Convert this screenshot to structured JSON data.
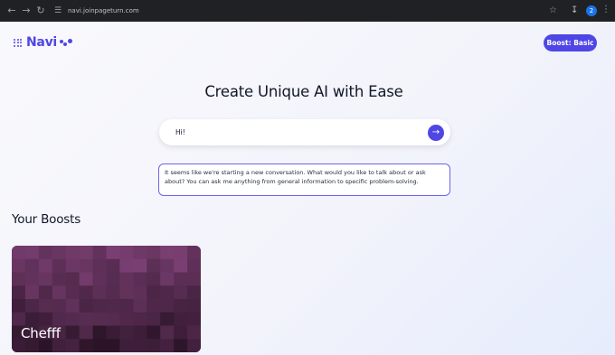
{
  "browser": {
    "url": "navi.joinpageturn.com",
    "profile_initial": "2",
    "icons": [
      "back-icon",
      "forward-icon",
      "reload-icon",
      "site-info-icon",
      "bookmark-star-icon",
      "download-icon",
      "more-menu-icon"
    ]
  },
  "header": {
    "logo_text": "Navi",
    "boost_button": "Boost: Basic"
  },
  "main": {
    "headline": "Create Unique AI with Ease",
    "chat_input_value": "Hi!",
    "response_text": "It seems like we're starting a new conversation. What would you like to talk about or ask about? You can ask me anything from general information to specific problem-solving."
  },
  "boosts": {
    "section_title": "Your Boosts",
    "cards": [
      {
        "title": "Chefff"
      }
    ]
  },
  "colors": {
    "accent": "#4f46e5",
    "response_border": "#6d64e8",
    "card_dark": "#2b1428",
    "card_light": "#7a3f72"
  }
}
